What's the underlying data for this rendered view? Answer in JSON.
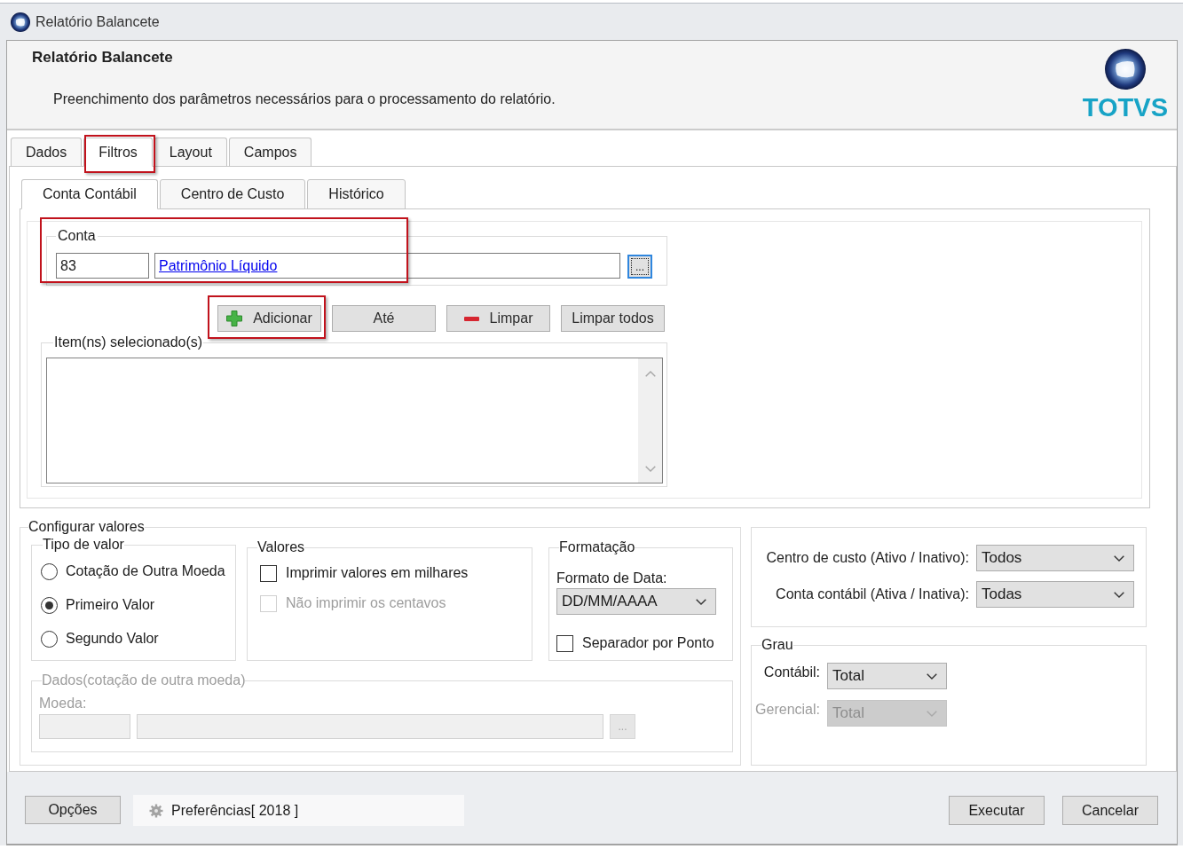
{
  "window": {
    "title": "Relatório Balancete"
  },
  "header": {
    "title": "Relatório Balancete",
    "description": "Preenchimento dos parâmetros necessários para o processamento do relatório.",
    "logo_text": "TOTVS"
  },
  "tabs": [
    {
      "label": "Dados",
      "selected": false,
      "highlighted": false
    },
    {
      "label": "Filtros",
      "selected": true,
      "highlighted": true
    },
    {
      "label": "Layout",
      "selected": false,
      "highlighted": false
    },
    {
      "label": "Campos",
      "selected": false,
      "highlighted": false
    }
  ],
  "subtabs": [
    {
      "label": "Conta Contábil",
      "selected": true
    },
    {
      "label": "Centro de Custo",
      "selected": false
    },
    {
      "label": "Histórico",
      "selected": false
    }
  ],
  "account": {
    "legend": "Conta",
    "code": "83",
    "description": "Patrimônio Líquido",
    "browse": {
      "label": "...",
      "focused": true
    },
    "highlighted": true
  },
  "actions": [
    {
      "kind": "add",
      "label": "Adicionar",
      "highlighted": true
    },
    {
      "kind": "plain",
      "label": "Até",
      "highlighted": false
    },
    {
      "kind": "remove",
      "label": "Limpar",
      "highlighted": false
    },
    {
      "kind": "plain",
      "label": "Limpar todos",
      "highlighted": false
    }
  ],
  "selected_items": {
    "legend": "Item(ns) selecionado(s)"
  },
  "configure": {
    "legend": "Configurar valores",
    "value_type": {
      "legend": "Tipo de valor",
      "options": [
        {
          "label": "Cotação de Outra Moeda",
          "selected": false
        },
        {
          "label": "Primeiro Valor",
          "selected": true
        },
        {
          "label": "Segundo Valor",
          "selected": false
        }
      ]
    },
    "values": {
      "legend": "Valores",
      "options": [
        {
          "label": "Imprimir valores em milhares",
          "checked": false,
          "disabled": false
        },
        {
          "label": "Não imprimir os centavos",
          "checked": false,
          "disabled": true
        }
      ]
    },
    "formatting": {
      "legend": "Formatação",
      "date_format_label": "Formato de Data:",
      "date_format": "DD/MM/AAAA",
      "dot_separator": {
        "label": "Separador por Ponto",
        "checked": false
      }
    },
    "currency": {
      "legend": "Dados(cotação de outra moeda)",
      "disabled": true,
      "currency_label": "Moeda:",
      "browse": "..."
    }
  },
  "status_filters": [
    {
      "label": "Centro de custo (Ativo / Inativo):",
      "value": "Todos"
    },
    {
      "label": "Conta contábil (Ativa / Inativa):",
      "value": "Todas"
    }
  ],
  "grau": {
    "legend": "Grau",
    "rows": [
      {
        "label": "Contábil:",
        "value": "Total",
        "disabled": false
      },
      {
        "label": "Gerencial:",
        "value": "Total",
        "disabled": true
      }
    ]
  },
  "footer": {
    "options_button": "Opções",
    "preferences": "Preferências[ 2018 ]",
    "buttons": [
      "Executar",
      "Cancelar"
    ]
  }
}
